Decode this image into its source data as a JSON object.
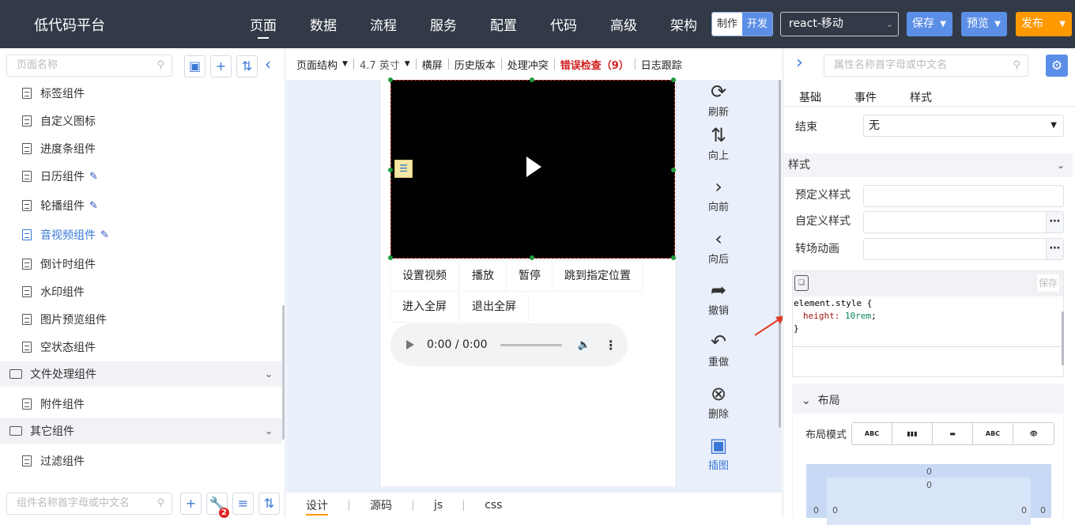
{
  "topbar": {
    "logo": "低代码平台",
    "nav": [
      "页面",
      "数据",
      "流程",
      "服务",
      "配置",
      "代码",
      "高级",
      "架构"
    ],
    "mode_a": "制作",
    "mode_b": "开发",
    "framework": "react-移动",
    "save": "保存",
    "preview": "预览",
    "publish": "发布"
  },
  "left": {
    "page_search_placeholder": "页面名称",
    "components": [
      "标签组件",
      "自定义图标",
      "进度条组件",
      "日历组件",
      "轮播组件",
      "音视频组件",
      "倒计时组件",
      "水印组件",
      "图片预览组件",
      "空状态组件"
    ],
    "group_file": "文件处理组件",
    "attach": "附件组件",
    "group_other": "其它组件",
    "filter": "过滤组件",
    "component_search_placeholder": "组件名称首字母或中文名",
    "badge_count": "2"
  },
  "canvas": {
    "toolbar": {
      "structure": "页面结构",
      "size": "4.7 英寸",
      "landscape": "横屏",
      "history": "历史版本",
      "conflict": "处理冲突",
      "error": "错误检查（9）",
      "log": "日志跟踪"
    },
    "actions": [
      "设置视频",
      "播放",
      "暂停",
      "跳到指定位置",
      "进入全屏",
      "退出全屏"
    ],
    "audio_time": "0:00 / 0:00",
    "tools": [
      "刷新",
      "向上",
      "向前",
      "向后",
      "撤销",
      "重做",
      "删除",
      "插图"
    ],
    "bottom_tabs": [
      "设计",
      "源码",
      "js",
      "css"
    ]
  },
  "right": {
    "search_placeholder": "属性名称首字母或中文名",
    "tabs": [
      "基础",
      "事件",
      "样式"
    ],
    "end_label": "结束",
    "end_value": "无",
    "style_section": "样式",
    "predef": "预定义样式",
    "custom": "自定义样式",
    "transition": "转场动画",
    "editor_save": "保存",
    "code_selector": "element.style {",
    "code_prop": "height:",
    "code_value": "10rem",
    "code_end": "}",
    "layout_section": "布局",
    "layout_mode": "布局模式",
    "mode_labels": [
      "ABC",
      "",
      "",
      "ABC",
      ""
    ],
    "box_numbers": [
      "0",
      "0",
      "0",
      "0",
      "0",
      "0"
    ]
  },
  "colors": {
    "topbar_bg": "#323a47",
    "accent_blue": "#5b8ee6",
    "publish_orange": "#ff9900",
    "error_red": "#d01f1f",
    "link_blue": "#3a78d6"
  }
}
